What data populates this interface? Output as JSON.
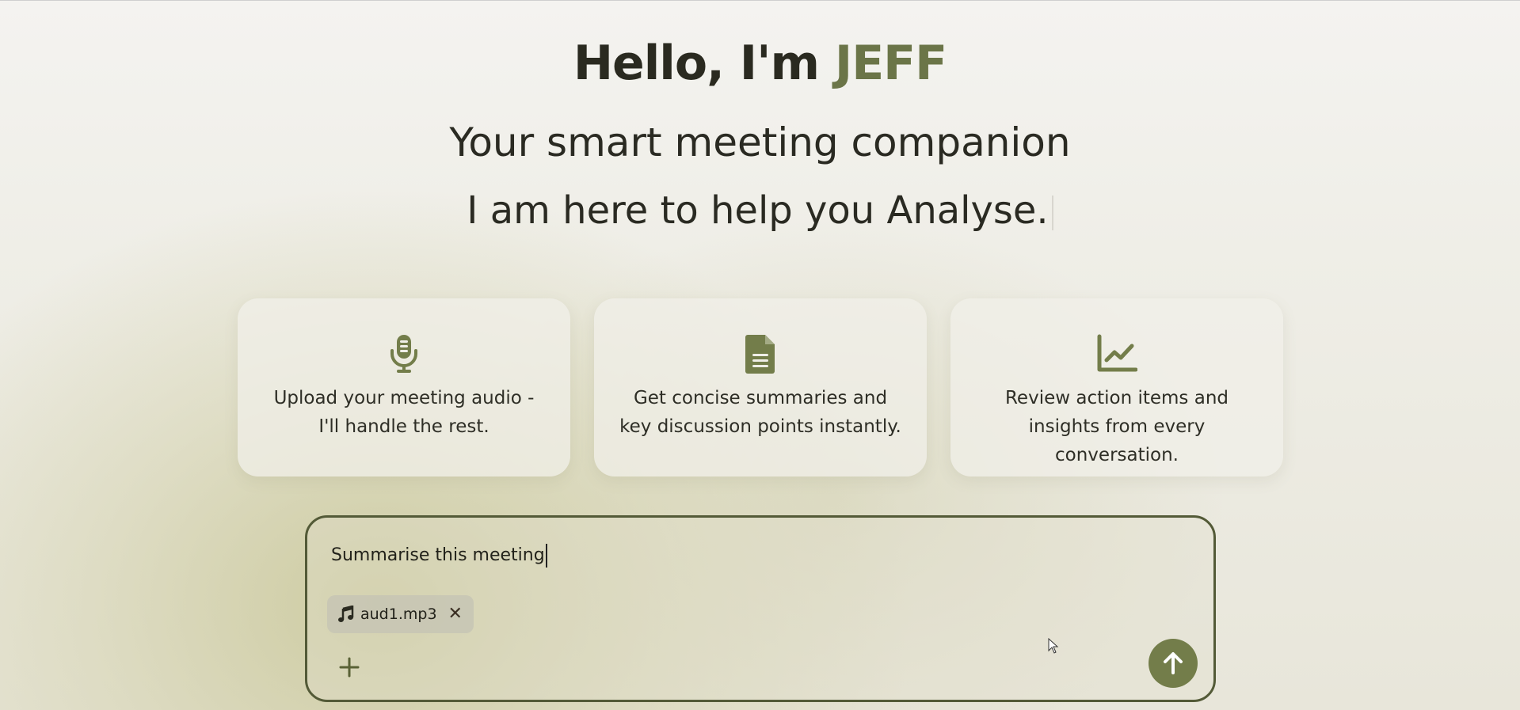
{
  "hero": {
    "greeting_prefix": "Hello, I'm ",
    "greeting_name": "JEFF",
    "subtitle": "Your smart meeting companion",
    "typing_text": "I am here to help you Analyse."
  },
  "cards": [
    {
      "icon": "microphone-icon",
      "text": "Upload your meeting audio - I'll handle the rest."
    },
    {
      "icon": "document-icon",
      "text": "Get concise summaries and key discussion points instantly."
    },
    {
      "icon": "line-chart-icon",
      "text": "Review action items and insights from every conversation."
    }
  ],
  "composer": {
    "input_value": "Summarise this meeting",
    "attachment": {
      "icon": "music-note-icon",
      "filename": "aud1.mp3",
      "remove_label": "✕"
    },
    "add_icon": "plus-icon",
    "send_icon": "arrow-up-icon"
  },
  "colors": {
    "accent": "#6b7548",
    "send_button": "#737d4a",
    "composer_border": "#535a37"
  }
}
